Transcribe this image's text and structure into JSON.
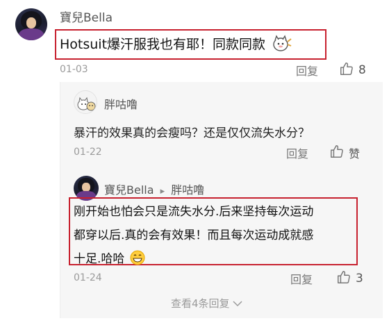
{
  "comments": [
    {
      "name": "寶兒Bella",
      "text": "Hotsuit爆汗服我也有耶！同款同款",
      "date": "01-03",
      "reply_label": "回复",
      "likes": "8"
    }
  ],
  "replies": [
    {
      "name": "胖咕噜",
      "text": "暴汗的效果真的会瘦吗？还是仅仅流失水分？",
      "date": "01-22",
      "reply_label": "回复",
      "likes_label": "赞"
    },
    {
      "name": "寶兒Bella",
      "arrow": "▸",
      "reply_to": "胖咕噜",
      "text_lines": [
        "刚开始也怕会只是流失水分.后来坚持每次运动",
        "都穿以后.真的会有效果！而且每次运动成就感",
        "十足.哈哈"
      ],
      "date": "01-24",
      "reply_label": "回复",
      "likes": "3"
    }
  ],
  "more_replies": "查看4条回复",
  "colors": {
    "highlight_box": "#c7202e",
    "muted": "#9a9a9a",
    "reply_bg": "#f6f6f6"
  },
  "icons": {
    "like": "thumbs-up-icon",
    "expand": "chevron-down-icon",
    "emoji": "grin-emoji-icon",
    "sticker": "cartoon-cat-sticker-icon"
  }
}
